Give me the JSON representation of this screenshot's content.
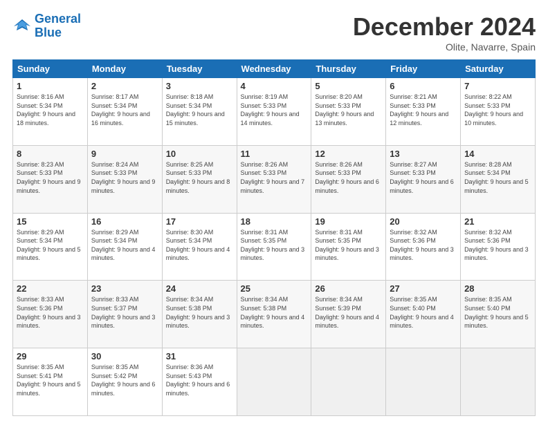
{
  "header": {
    "logo_line1": "General",
    "logo_line2": "Blue",
    "month": "December 2024",
    "location": "Olite, Navarre, Spain"
  },
  "weekdays": [
    "Sunday",
    "Monday",
    "Tuesday",
    "Wednesday",
    "Thursday",
    "Friday",
    "Saturday"
  ],
  "weeks": [
    [
      {
        "day": "1",
        "info": "Sunrise: 8:16 AM\nSunset: 5:34 PM\nDaylight: 9 hours and 18 minutes."
      },
      {
        "day": "2",
        "info": "Sunrise: 8:17 AM\nSunset: 5:34 PM\nDaylight: 9 hours and 16 minutes."
      },
      {
        "day": "3",
        "info": "Sunrise: 8:18 AM\nSunset: 5:34 PM\nDaylight: 9 hours and 15 minutes."
      },
      {
        "day": "4",
        "info": "Sunrise: 8:19 AM\nSunset: 5:33 PM\nDaylight: 9 hours and 14 minutes."
      },
      {
        "day": "5",
        "info": "Sunrise: 8:20 AM\nSunset: 5:33 PM\nDaylight: 9 hours and 13 minutes."
      },
      {
        "day": "6",
        "info": "Sunrise: 8:21 AM\nSunset: 5:33 PM\nDaylight: 9 hours and 12 minutes."
      },
      {
        "day": "7",
        "info": "Sunrise: 8:22 AM\nSunset: 5:33 PM\nDaylight: 9 hours and 10 minutes."
      }
    ],
    [
      {
        "day": "8",
        "info": "Sunrise: 8:23 AM\nSunset: 5:33 PM\nDaylight: 9 hours and 9 minutes."
      },
      {
        "day": "9",
        "info": "Sunrise: 8:24 AM\nSunset: 5:33 PM\nDaylight: 9 hours and 9 minutes."
      },
      {
        "day": "10",
        "info": "Sunrise: 8:25 AM\nSunset: 5:33 PM\nDaylight: 9 hours and 8 minutes."
      },
      {
        "day": "11",
        "info": "Sunrise: 8:26 AM\nSunset: 5:33 PM\nDaylight: 9 hours and 7 minutes."
      },
      {
        "day": "12",
        "info": "Sunrise: 8:26 AM\nSunset: 5:33 PM\nDaylight: 9 hours and 6 minutes."
      },
      {
        "day": "13",
        "info": "Sunrise: 8:27 AM\nSunset: 5:33 PM\nDaylight: 9 hours and 6 minutes."
      },
      {
        "day": "14",
        "info": "Sunrise: 8:28 AM\nSunset: 5:34 PM\nDaylight: 9 hours and 5 minutes."
      }
    ],
    [
      {
        "day": "15",
        "info": "Sunrise: 8:29 AM\nSunset: 5:34 PM\nDaylight: 9 hours and 5 minutes."
      },
      {
        "day": "16",
        "info": "Sunrise: 8:29 AM\nSunset: 5:34 PM\nDaylight: 9 hours and 4 minutes."
      },
      {
        "day": "17",
        "info": "Sunrise: 8:30 AM\nSunset: 5:34 PM\nDaylight: 9 hours and 4 minutes."
      },
      {
        "day": "18",
        "info": "Sunrise: 8:31 AM\nSunset: 5:35 PM\nDaylight: 9 hours and 3 minutes."
      },
      {
        "day": "19",
        "info": "Sunrise: 8:31 AM\nSunset: 5:35 PM\nDaylight: 9 hours and 3 minutes."
      },
      {
        "day": "20",
        "info": "Sunrise: 8:32 AM\nSunset: 5:36 PM\nDaylight: 9 hours and 3 minutes."
      },
      {
        "day": "21",
        "info": "Sunrise: 8:32 AM\nSunset: 5:36 PM\nDaylight: 9 hours and 3 minutes."
      }
    ],
    [
      {
        "day": "22",
        "info": "Sunrise: 8:33 AM\nSunset: 5:36 PM\nDaylight: 9 hours and 3 minutes."
      },
      {
        "day": "23",
        "info": "Sunrise: 8:33 AM\nSunset: 5:37 PM\nDaylight: 9 hours and 3 minutes."
      },
      {
        "day": "24",
        "info": "Sunrise: 8:34 AM\nSunset: 5:38 PM\nDaylight: 9 hours and 3 minutes."
      },
      {
        "day": "25",
        "info": "Sunrise: 8:34 AM\nSunset: 5:38 PM\nDaylight: 9 hours and 4 minutes."
      },
      {
        "day": "26",
        "info": "Sunrise: 8:34 AM\nSunset: 5:39 PM\nDaylight: 9 hours and 4 minutes."
      },
      {
        "day": "27",
        "info": "Sunrise: 8:35 AM\nSunset: 5:40 PM\nDaylight: 9 hours and 4 minutes."
      },
      {
        "day": "28",
        "info": "Sunrise: 8:35 AM\nSunset: 5:40 PM\nDaylight: 9 hours and 5 minutes."
      }
    ],
    [
      {
        "day": "29",
        "info": "Sunrise: 8:35 AM\nSunset: 5:41 PM\nDaylight: 9 hours and 5 minutes."
      },
      {
        "day": "30",
        "info": "Sunrise: 8:35 AM\nSunset: 5:42 PM\nDaylight: 9 hours and 6 minutes."
      },
      {
        "day": "31",
        "info": "Sunrise: 8:36 AM\nSunset: 5:43 PM\nDaylight: 9 hours and 6 minutes."
      },
      null,
      null,
      null,
      null
    ]
  ]
}
